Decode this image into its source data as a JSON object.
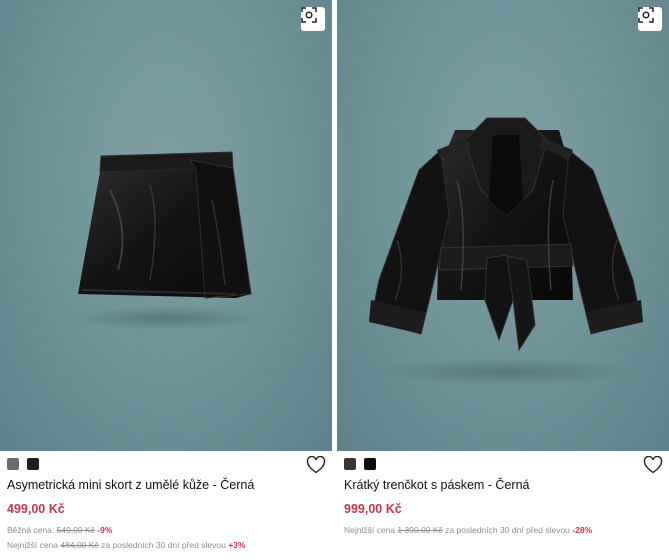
{
  "colors": {
    "photo_background": "#6f9198",
    "price": "#c8364a",
    "muted_text": "#8d8d8d"
  },
  "products": [
    {
      "name": "Asymetrická mini skort z umělé kůže - Černá",
      "price": "499,00 Kč",
      "image_icon": "visual-search-icon",
      "favorite_icon": "heart-icon",
      "swatches": [
        "#6b6b6b",
        "#1e1e1e"
      ],
      "price_info_1": {
        "label": "Běžná cena",
        "old_price": "549,00 Kč",
        "discount": "-9%"
      },
      "price_info_2": {
        "label": "Nejnižší cena",
        "old_price": "484,00 Kč",
        "note": "za posledních 30 dní před slevou",
        "change": "+3%"
      }
    },
    {
      "name": "Krátký trenčkot s páskem - Černá",
      "price": "999,00 Kč",
      "image_icon": "visual-search-icon",
      "favorite_icon": "heart-icon",
      "swatches": [
        "#3a3430",
        "#0d0d0d"
      ],
      "price_info_1": {
        "label": "Nejnižší cena",
        "old_price": "1 390,00 Kč",
        "note": "za posledních 30 dní před slevou",
        "discount": "-28%"
      }
    }
  ]
}
